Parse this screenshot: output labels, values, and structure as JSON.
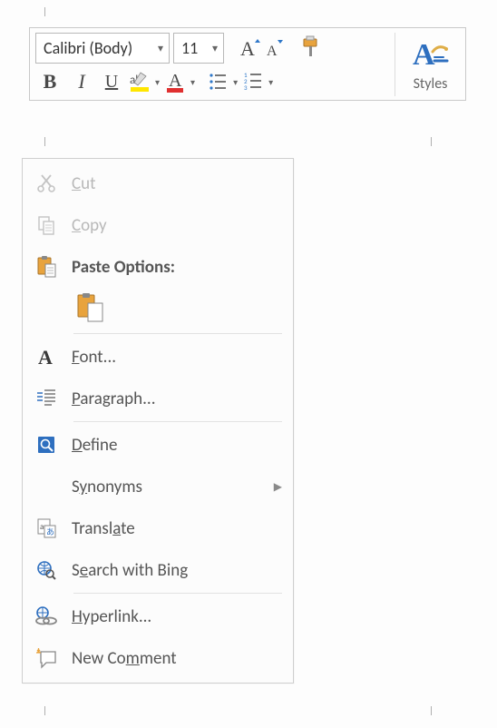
{
  "toolbar": {
    "font_name": "Calibri (Body)",
    "font_size": "11",
    "bold_label": "B",
    "italic_label": "I",
    "underline_label": "U",
    "styles_label": "Styles"
  },
  "menu": {
    "cut": "Cut",
    "copy": "Copy",
    "paste_options": "Paste Options:",
    "font": "Font...",
    "paragraph": "Paragraph...",
    "define": "Define",
    "synonyms": "Synonyms",
    "translate": "Translate",
    "search_bing": "Search with Bing",
    "hyperlink": "Hyperlink...",
    "new_comment": "New Comment"
  }
}
